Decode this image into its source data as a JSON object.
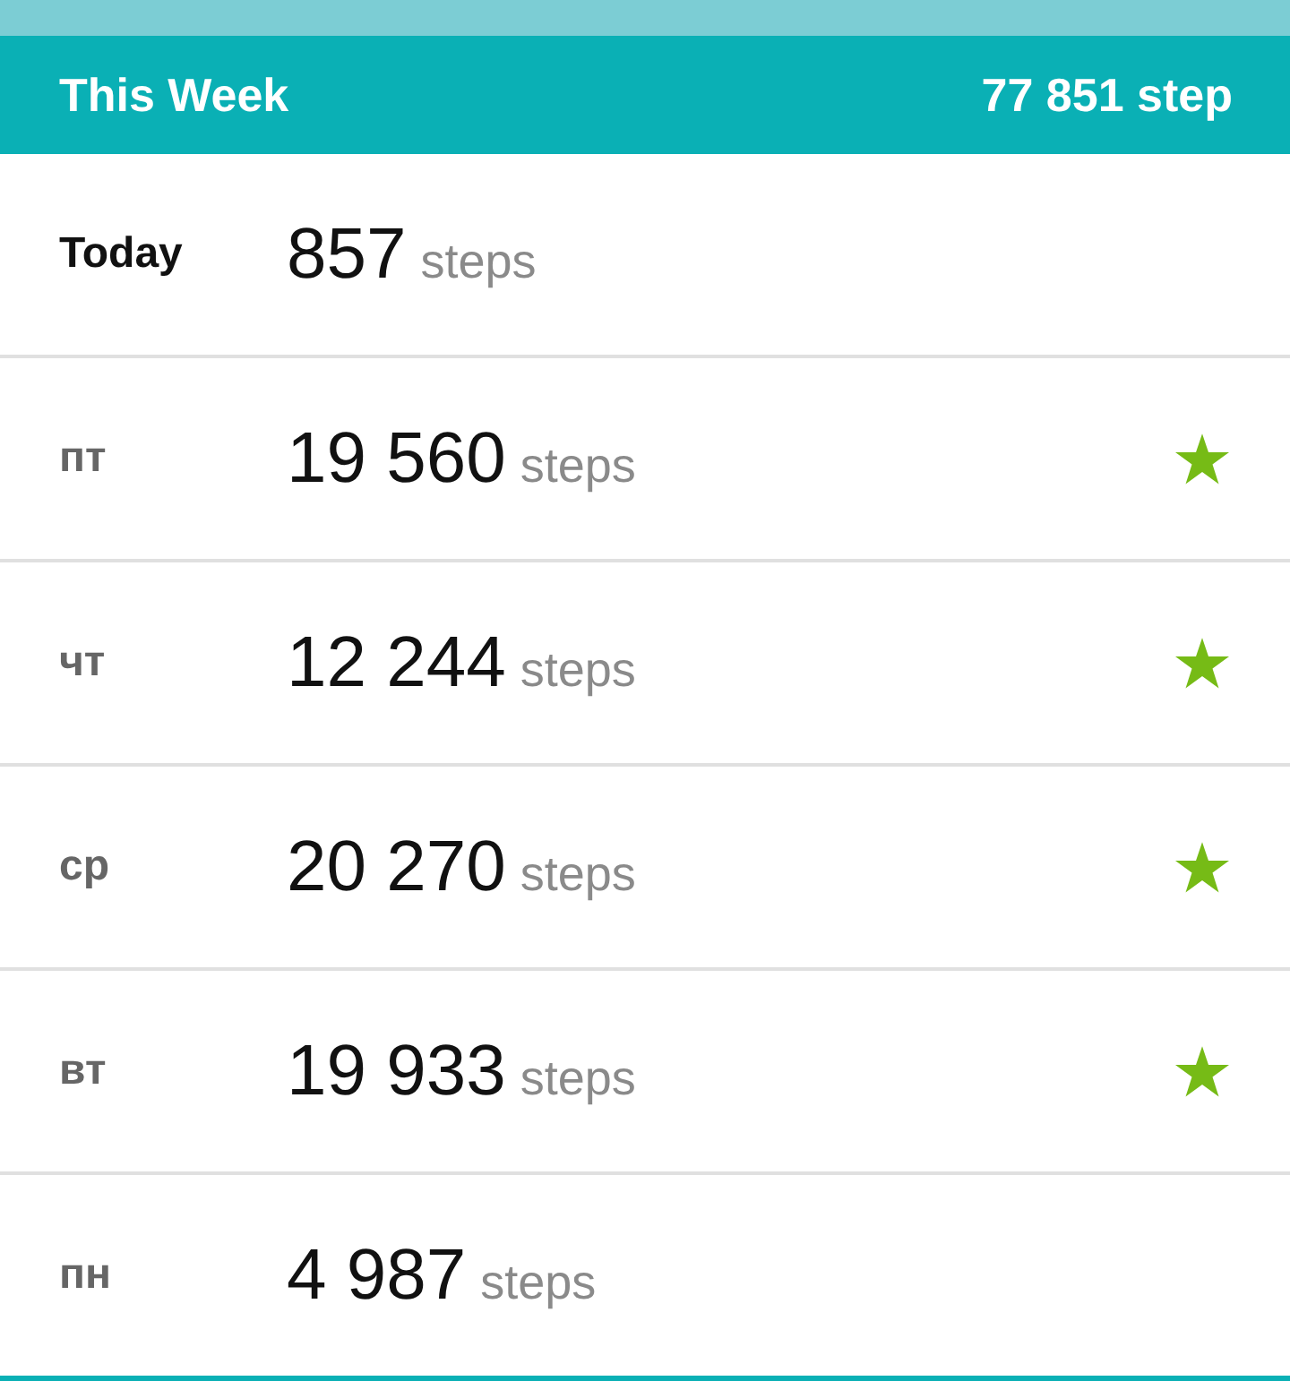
{
  "header": {
    "title": "This Week",
    "total": "77 851 step"
  },
  "days": [
    {
      "label": "Today",
      "current": true,
      "count": "857",
      "unit": "steps",
      "goal_met": false
    },
    {
      "label": "пт",
      "current": false,
      "count": "19 560",
      "unit": "steps",
      "goal_met": true
    },
    {
      "label": "чт",
      "current": false,
      "count": "12 244",
      "unit": "steps",
      "goal_met": true
    },
    {
      "label": "ср",
      "current": false,
      "count": "20 270",
      "unit": "steps",
      "goal_met": true
    },
    {
      "label": "вт",
      "current": false,
      "count": "19 933",
      "unit": "steps",
      "goal_met": true
    },
    {
      "label": "пн",
      "current": false,
      "count": "4 987",
      "unit": "steps",
      "goal_met": false
    }
  ]
}
